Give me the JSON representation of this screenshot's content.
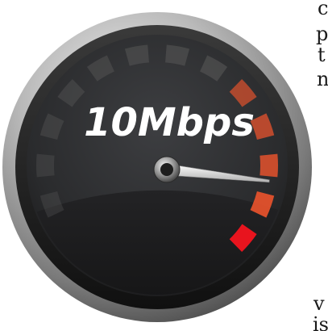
{
  "speedometer": {
    "reading": "10Mbps",
    "needle_fraction": 0.86,
    "colors": {
      "dial_face": "#2c2d2f",
      "scale_gray": "#555555",
      "scale_orange": "#e8532d",
      "scale_red": "#e8141e",
      "needle": "#d9d9d9",
      "text": "#ffffff"
    },
    "icon": "speedometer-gauge-icon"
  },
  "side_text": {
    "letters": [
      "c",
      "p",
      "t",
      "n",
      "v",
      "is"
    ]
  }
}
